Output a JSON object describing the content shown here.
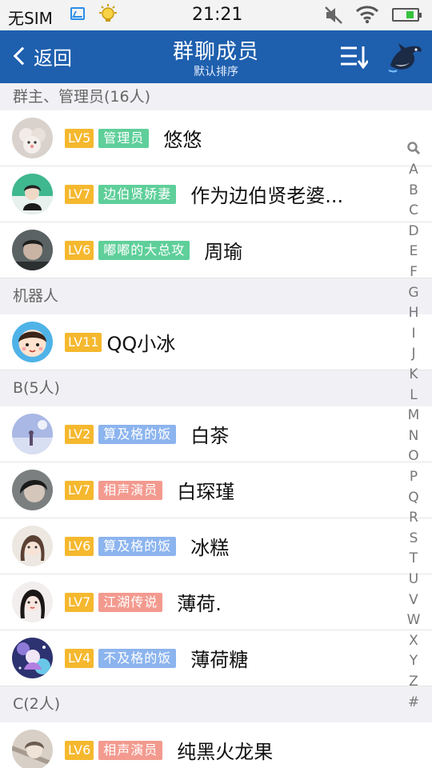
{
  "status_bar": {
    "carrier": "无SIM",
    "time": "21:21",
    "battery_level": 0.35
  },
  "nav": {
    "back_label": "返回",
    "title": "群聊成员",
    "subtitle": "默认排序",
    "sort_icon": "sort-list-icon",
    "mascot_icon": "dolphin-mascot-icon"
  },
  "sections": {
    "s0": {
      "header": "群主、管理员(16人)"
    },
    "s1": {
      "header": "机器人"
    },
    "s2": {
      "header": "B(5人)"
    },
    "s3": {
      "header": "C(2人)"
    }
  },
  "members": {
    "m0": {
      "level": "LV5",
      "title": "管理员",
      "title_color": "#5fcf9a",
      "name": "悠悠"
    },
    "m1": {
      "level": "LV7",
      "title": "边伯贤娇妻",
      "title_color": "#5fcf9a",
      "name": "作为边伯贤老婆..."
    },
    "m2": {
      "level": "LV6",
      "title": "嘟嘟的大总攻",
      "title_color": "#5fcf9a",
      "name": "周瑜"
    },
    "m3": {
      "level": "LV11",
      "name": "QQ小冰"
    },
    "m4": {
      "level": "LV2",
      "title": "算及格的饭",
      "title_color": "#8cb4ee",
      "name": "白茶"
    },
    "m5": {
      "level": "LV7",
      "title": "相声演员",
      "title_color": "#f39a8f",
      "name": "白琛瑾"
    },
    "m6": {
      "level": "LV6",
      "title": "算及格的饭",
      "title_color": "#8cb4ee",
      "name": "冰糕"
    },
    "m7": {
      "level": "LV7",
      "title": "江湖传说",
      "title_color": "#f39a8f",
      "name": "薄荷."
    },
    "m8": {
      "level": "LV4",
      "title": "不及格的饭",
      "title_color": "#8cb4ee",
      "name": "薄荷糖"
    },
    "m9": {
      "level": "LV6",
      "title": "相声演员",
      "title_color": "#f39a8f",
      "name": "纯黑火龙果"
    }
  },
  "index_letters": [
    "A",
    "B",
    "C",
    "D",
    "E",
    "F",
    "G",
    "H",
    "I",
    "J",
    "K",
    "L",
    "M",
    "N",
    "O",
    "P",
    "Q",
    "R",
    "S",
    "T",
    "U",
    "V",
    "W",
    "X",
    "Y",
    "Z",
    "#"
  ],
  "colors": {
    "nav_bg": "#1e5fae",
    "level_badge": "#f5b82e",
    "section_bg": "#f1f1f5"
  }
}
